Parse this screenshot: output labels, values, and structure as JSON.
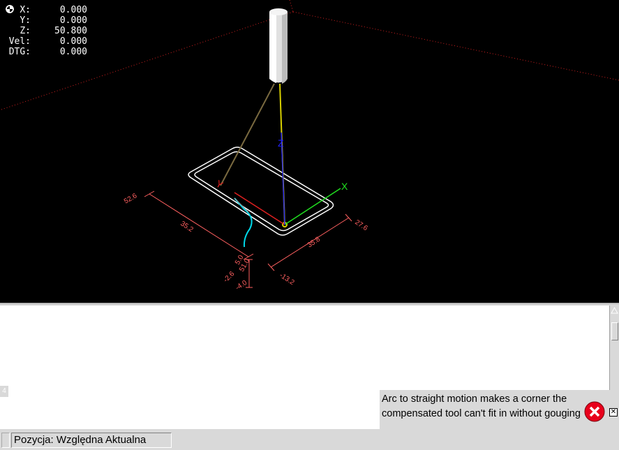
{
  "dro": {
    "rows": [
      {
        "label": "X:",
        "value": "0.000",
        "homed": true
      },
      {
        "label": "Y:",
        "value": "0.000",
        "homed": true
      },
      {
        "label": "Z:",
        "value": "50.800",
        "homed": true
      },
      {
        "label": "Vel:",
        "value": "0.000",
        "homed": false
      },
      {
        "label": "DTG:",
        "value": "0.000",
        "homed": false
      }
    ]
  },
  "preview": {
    "axis_labels": {
      "x": "X",
      "y": "Y",
      "z": "Z"
    },
    "dimensions": [
      "52.6",
      "35.2",
      "35.8",
      "27.6",
      "5.0",
      "-2.6",
      "-13.2",
      "-4.0",
      "51.0"
    ]
  },
  "output": {
    "line_marker": "4"
  },
  "error": {
    "message": "Arc to straight motion makes a corner the compensated tool can't fit in without gouging",
    "icon": "error-x-icon",
    "close_icon": "close-icon",
    "icon_color": "#e8001c"
  },
  "status": {
    "position_text": "Pozycja: Względna Aktualna"
  },
  "colors": {
    "background": "#000000",
    "limits": "#d02020",
    "axis_x": "#20e020",
    "axis_y": "#e02020",
    "axis_z": "#2020f0",
    "feed_path": "#ffffff",
    "traverse": "#d8d000",
    "dimension": "#ff6060",
    "compensation": "#00d8e8"
  }
}
